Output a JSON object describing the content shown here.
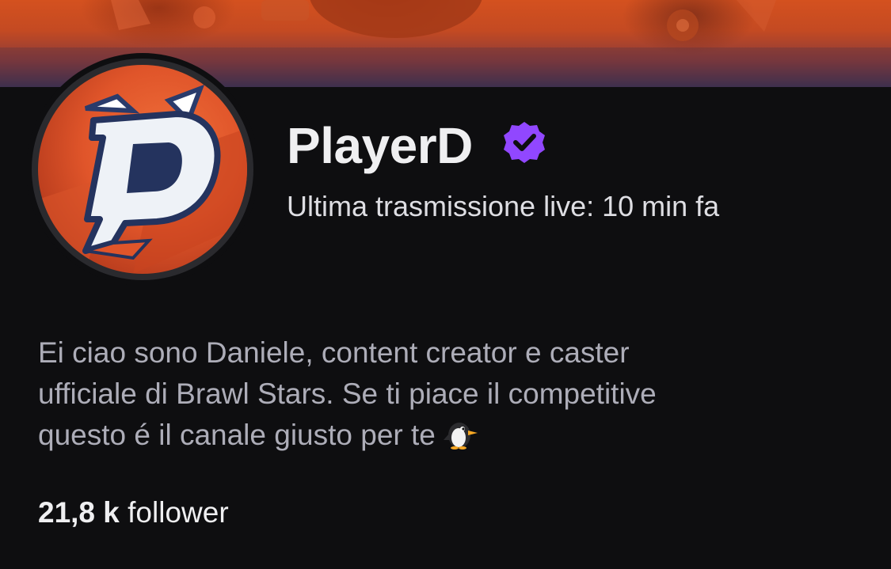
{
  "channel": {
    "name": "PlayerD",
    "verified": true,
    "last_live": "Ultima trasmissione live: 10 min fa",
    "avatar_letter": "D"
  },
  "bio": {
    "lines": [
      "Ei ciao sono Daniele, content creator e caster",
      "ufficiale di Brawl Stars. Se ti piace il competitive",
      "questo é il canale giusto per te"
    ],
    "emoji": "penguin-emoji"
  },
  "stats": {
    "followers_count": "21,8 k",
    "followers_label": "follower"
  },
  "colors": {
    "background": "#0e0e10",
    "verified_badge": "#9147ff",
    "banner_orange": "#d4511f",
    "text_primary": "#efeff1",
    "text_secondary": "#adadb8"
  }
}
